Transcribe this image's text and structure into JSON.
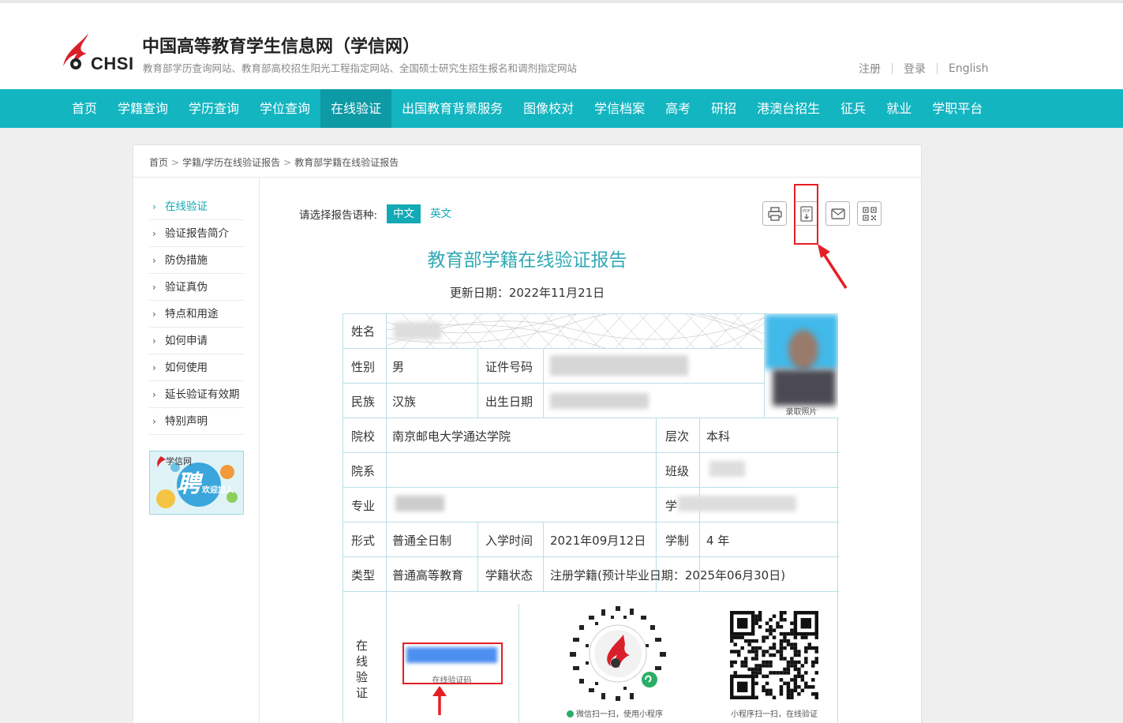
{
  "header": {
    "logo_text": "CHSI",
    "site_title": "中国高等教育学生信息网（学信网）",
    "site_subtitle": "教育部学历查询网站、教育部高校招生阳光工程指定网站、全国硕士研究生招生报名和调剂指定网站",
    "links": [
      "注册",
      "登录",
      "English"
    ]
  },
  "nav": {
    "items": [
      "首页",
      "学籍查询",
      "学历查询",
      "学位查询",
      "在线验证",
      "出国教育背景服务",
      "图像校对",
      "学信档案",
      "高考",
      "研招",
      "港澳台招生",
      "征兵",
      "就业",
      "学职平台"
    ],
    "active_index": 4
  },
  "breadcrumb": [
    "首页",
    "学籍/学历在线验证报告",
    "教育部学籍在线验证报告"
  ],
  "sidebar": {
    "items": [
      "在线验证",
      "验证报告简介",
      "防伪措施",
      "验证真伪",
      "特点和用途",
      "如何申请",
      "如何使用",
      "延长验证有效期",
      "特别声明"
    ],
    "active_index": 0,
    "ad": {
      "brand": "学信网",
      "big": "聘",
      "slogan": "欢迎加入"
    }
  },
  "report": {
    "lang_label": "请选择报告语种:",
    "lang_options": [
      "中文",
      "英文"
    ],
    "selected_lang": "中文",
    "tools": [
      "print-icon",
      "pdf-download-icon",
      "email-icon",
      "qrcode-icon"
    ],
    "title": "教育部学籍在线验证报告",
    "update_date": "更新日期：2022年11月21日",
    "fields": {
      "name_label": "姓名",
      "gender_label": "性别",
      "gender": "男",
      "id_label": "证件号码",
      "ethnicity_label": "民族",
      "ethnicity": "汉族",
      "birth_label": "出生日期",
      "school_label": "院校",
      "school": "南京邮电大学通达学院",
      "level_label": "层次",
      "level": "本科",
      "dept_label": "院系",
      "class_label": "班级",
      "major_label": "专业",
      "student_id_label": "学号",
      "form_label": "形式",
      "form": "普通全日制",
      "enroll_label": "入学时间",
      "enroll": "2021年09月12日",
      "duration_label": "学制",
      "duration": "4 年",
      "type_label": "类型",
      "type": "普通高等教育",
      "status_label": "学籍状态",
      "status": "注册学籍(预计毕业日期：2025年06月30日)",
      "verify_label": "在线验证",
      "verify_code_label": "在线验证码",
      "qr1_caption": "微信扫一扫，使用小程序",
      "qr2_caption": "小程序扫一扫，在线验证",
      "photo_caption": "录取照片"
    }
  },
  "colors": {
    "nav_bg": "#13b5c1",
    "accent": "#13a9b5",
    "annotation_red": "#e51e25"
  }
}
